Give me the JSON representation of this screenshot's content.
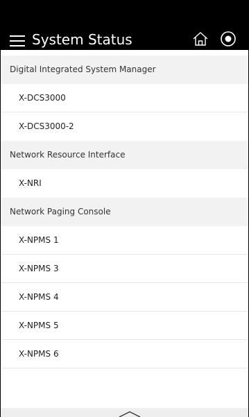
{
  "header": {
    "title": "System Status",
    "menu_icon": "hamburger-menu-icon",
    "home_icon": "home-icon",
    "stop_icon": "stop-icon",
    "background_color": "#000000",
    "text_color": "#ffffff"
  },
  "groups": [
    {
      "label": "Digital Integrated System Manager",
      "items": [
        {
          "label": "X-DCS3000"
        },
        {
          "label": "X-DCS3000-2"
        }
      ]
    },
    {
      "label": "Network Resource Interface",
      "items": [
        {
          "label": "X-NRI"
        }
      ]
    },
    {
      "label": "Network Paging Console",
      "items": [
        {
          "label": "X-NPMS 1"
        },
        {
          "label": "X-NPMS 3"
        },
        {
          "label": "X-NPMS 4"
        },
        {
          "label": "X-NPMS 5"
        },
        {
          "label": "X-NPMS 6"
        }
      ]
    }
  ],
  "footer": {
    "icon": "chevron-up-icon"
  }
}
